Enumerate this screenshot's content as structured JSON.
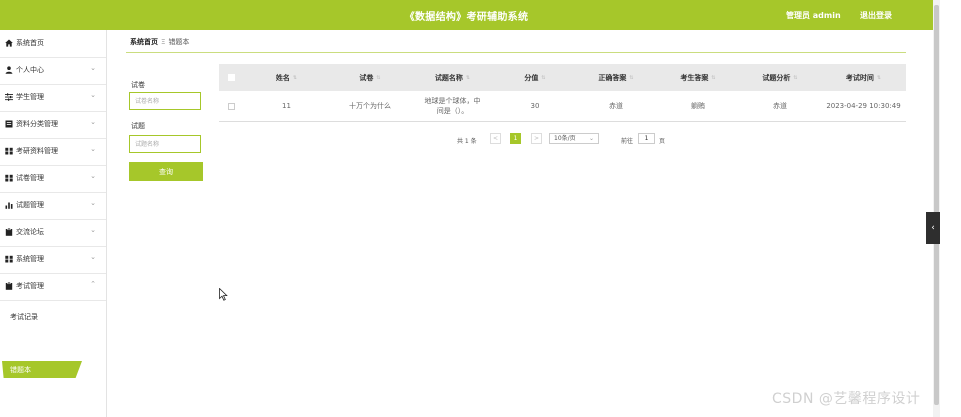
{
  "header": {
    "title": "《数据结构》考研辅助系统",
    "admin": "管理员 admin",
    "logout": "退出登录"
  },
  "sidebar": {
    "items": [
      {
        "label": "系统首页",
        "icon": "home-icon",
        "expandable": false
      },
      {
        "label": "个人中心",
        "icon": "person-icon",
        "expandable": true
      },
      {
        "label": "学生管理",
        "icon": "sliders-icon",
        "expandable": true
      },
      {
        "label": "资料分类管理",
        "icon": "doc-icon",
        "expandable": true
      },
      {
        "label": "考研资料管理",
        "icon": "grid-icon",
        "expandable": true
      },
      {
        "label": "试卷管理",
        "icon": "grid-icon",
        "expandable": true
      },
      {
        "label": "试题管理",
        "icon": "bar-chart-icon",
        "expandable": true
      },
      {
        "label": "交流论坛",
        "icon": "clipboard-icon",
        "expandable": true
      },
      {
        "label": "系统管理",
        "icon": "grid-icon",
        "expandable": true
      },
      {
        "label": "考试管理",
        "icon": "clipboard-icon",
        "expandable": true,
        "expanded": true
      }
    ],
    "sub_items": [
      {
        "label": "考试记录",
        "active": false
      },
      {
        "label": "错题本",
        "active": true
      }
    ]
  },
  "breadcrumb": {
    "home": "系统首页",
    "separator": "Ξ",
    "current": "错题本"
  },
  "search": {
    "paper_label": "试卷",
    "paper_placeholder": "试卷名称",
    "question_label": "试题",
    "question_placeholder": "试题名称",
    "query_button": "查询"
  },
  "table": {
    "columns": [
      "姓名",
      "试卷",
      "试题名称",
      "分值",
      "正确答案",
      "考生答案",
      "试题分析",
      "考试时间"
    ],
    "rows": [
      [
        "11",
        "十万个为什么",
        "地球是个球体，中间是（）。",
        "30",
        "赤道",
        "躺贿",
        "赤道",
        "2023-04-29 10:30:49"
      ]
    ]
  },
  "pagination": {
    "total": "共 1 条",
    "current_page": "1",
    "page_size": "10条/页",
    "goto_label": "前往",
    "goto_value": "1",
    "page_unit": "页"
  },
  "watermark": "CSDN @艺馨程序设计",
  "colors": {
    "accent": "#a6c72a",
    "header_bg": "#a6c72a",
    "table_header_bg": "#e9e9e9"
  }
}
